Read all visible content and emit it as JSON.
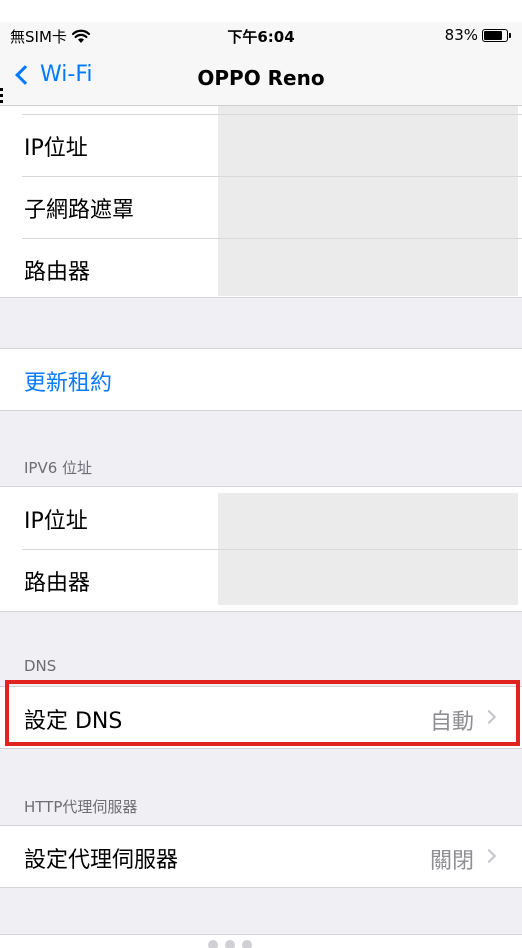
{
  "status_bar": {
    "carrier": "無SIM卡",
    "wifi_icon": "wifi-icon",
    "time": "下午6:04",
    "battery_percent": "83%",
    "battery_level": 0.83
  },
  "nav": {
    "back_label": "Wi-Fi",
    "title": "OPPO Reno"
  },
  "ipv4": {
    "ip_label": "IP位址",
    "subnet_label": "子網路遮罩",
    "router_label": "路由器"
  },
  "renew_lease": "更新租約",
  "ipv6": {
    "header": "IPV6 位址",
    "ip_label": "IP位址",
    "router_label": "路由器"
  },
  "dns": {
    "header": "DNS",
    "configure_label": "設定 DNS",
    "configure_value": "自動"
  },
  "proxy": {
    "header": "HTTP代理伺服器",
    "configure_label": "設定代理伺服器",
    "configure_value": "關閉"
  },
  "colors": {
    "accent": "#007aff",
    "highlight": "#e1231f",
    "background": "#efeff4"
  }
}
